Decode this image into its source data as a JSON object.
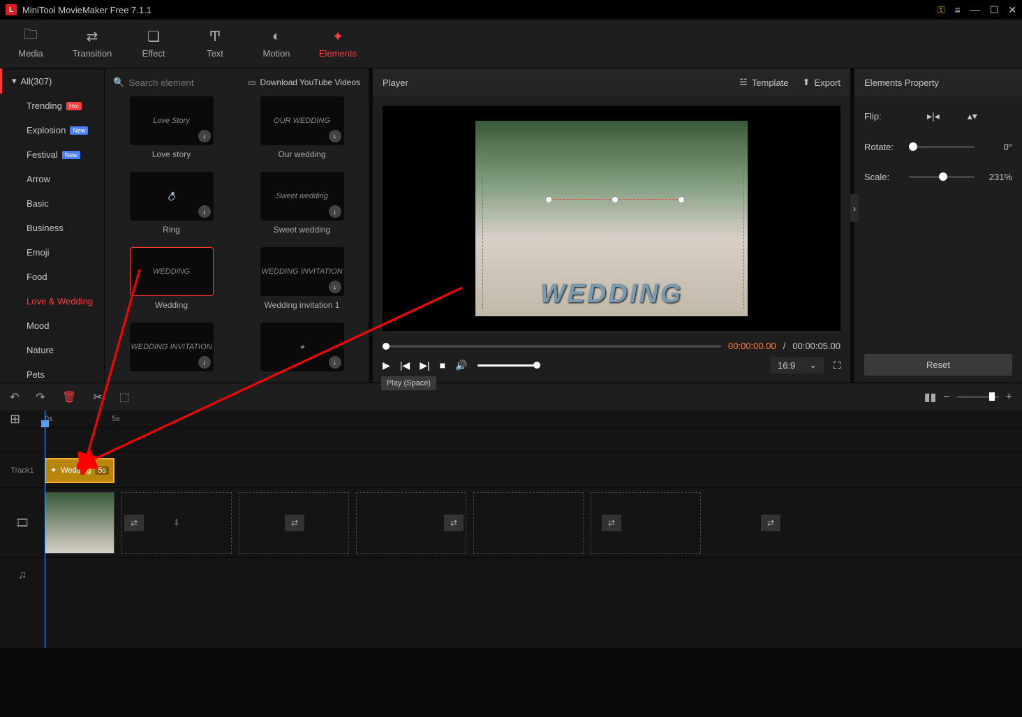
{
  "app": {
    "title": "MiniTool MovieMaker Free 7.1.1"
  },
  "toolbar": {
    "media": "Media",
    "transition": "Transition",
    "effect": "Effect",
    "text": "Text",
    "motion": "Motion",
    "elements": "Elements"
  },
  "sidebar": {
    "all": "All(307)",
    "items": [
      {
        "label": "Trending",
        "badge": "Hot",
        "badgeClass": "badge-hot"
      },
      {
        "label": "Explosion",
        "badge": "New",
        "badgeClass": "badge-new"
      },
      {
        "label": "Festival",
        "badge": "New",
        "badgeClass": "badge-new"
      },
      {
        "label": "Arrow"
      },
      {
        "label": "Basic"
      },
      {
        "label": "Business"
      },
      {
        "label": "Emoji"
      },
      {
        "label": "Food"
      },
      {
        "label": "Love & Wedding",
        "active": true
      },
      {
        "label": "Mood"
      },
      {
        "label": "Nature"
      },
      {
        "label": "Pets"
      }
    ]
  },
  "gallery": {
    "search_placeholder": "Search element",
    "download_youtube": "Download YouTube Videos",
    "items": [
      {
        "label": "Love story",
        "thumb": "Love Story",
        "dl": true
      },
      {
        "label": "Our wedding",
        "thumb": "OUR WEDDING",
        "dl": true
      },
      {
        "label": "Ring",
        "thumb": "💍",
        "dl": true
      },
      {
        "label": "Sweet wedding",
        "thumb": "Sweet wedding",
        "dl": true
      },
      {
        "label": "Wedding",
        "thumb": "WEDDING",
        "selected": true
      },
      {
        "label": "Wedding invitation 1",
        "thumb": "WEDDING INVITATION",
        "dl": true
      },
      {
        "label": "",
        "thumb": "WEDDING INVITATION",
        "dl": true
      },
      {
        "label": "",
        "thumb": "✦",
        "dl": true
      }
    ]
  },
  "player": {
    "title": "Player",
    "template": "Template",
    "export": "Export",
    "overlay": "WEDDING",
    "current": "00:00:00.00",
    "total": "00:00:05.00",
    "sep": "/",
    "aspect": "16:9",
    "tooltip": "Play (Space)"
  },
  "props": {
    "title": "Elements Property",
    "flip": "Flip:",
    "rotate": "Rotate:",
    "rotate_val": "0°",
    "scale": "Scale:",
    "scale_val": "231%",
    "reset": "Reset"
  },
  "timeline": {
    "t0": "0s",
    "t5": "5s",
    "track1": "Track1",
    "clip": {
      "name": "Wedding",
      "dur": "5s"
    }
  }
}
